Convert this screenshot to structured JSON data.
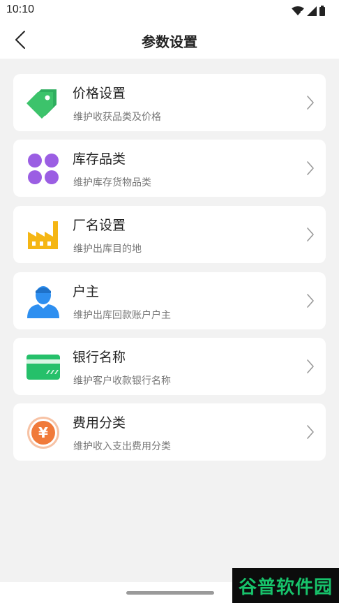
{
  "status_bar": {
    "time": "10:10"
  },
  "header": {
    "title": "参数设置"
  },
  "items": [
    {
      "title": "价格设置",
      "subtitle": "维护收获品类及价格",
      "icon": "price-tag-icon"
    },
    {
      "title": "库存品类",
      "subtitle": "维护库存货物品类",
      "icon": "category-grid-icon"
    },
    {
      "title": "厂名设置",
      "subtitle": "维护出库目的地",
      "icon": "factory-icon"
    },
    {
      "title": "户主",
      "subtitle": "维护出库回款账户户主",
      "icon": "person-icon"
    },
    {
      "title": "银行名称",
      "subtitle": "维护客户收款银行名称",
      "icon": "bank-card-icon"
    },
    {
      "title": "费用分类",
      "subtitle": "维护收入支出费用分类",
      "icon": "yuan-coin-icon"
    }
  ],
  "watermark": {
    "text": "谷普软件园"
  },
  "colors": {
    "tag_green": "#3cc36b",
    "purple": "#9b5ee3",
    "factory_yellow": "#f5b614",
    "person_blue": "#2e8ff0",
    "card_green": "#25c06a",
    "coin_orange": "#f07a3a"
  }
}
